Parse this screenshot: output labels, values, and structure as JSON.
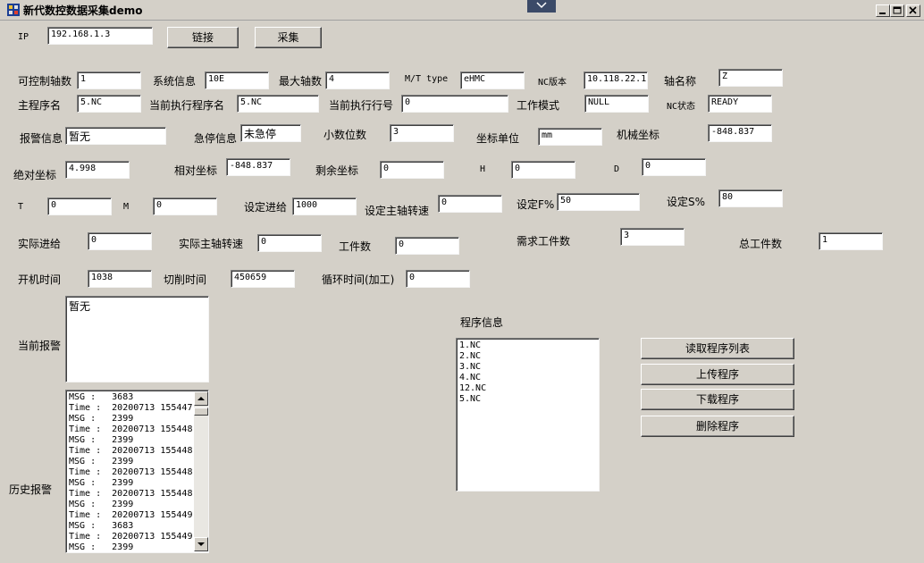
{
  "window": {
    "title": "新代数控数据采集demo",
    "controls": {
      "minimize": "minimize",
      "maximize": "maximize",
      "close": "close"
    }
  },
  "connection": {
    "ip_label": "IP",
    "ip_value": "192.168.1.3",
    "connect_label": "链接",
    "collect_label": "采集"
  },
  "fields": {
    "axis_count": {
      "label": "可控制轴数",
      "value": "1"
    },
    "sys_info": {
      "label": "系统信息",
      "value": "10E"
    },
    "max_axis": {
      "label": "最大轴数",
      "value": "4"
    },
    "mt_type": {
      "label": "M/T type",
      "value": "eHMC"
    },
    "nc_version": {
      "label": "NC版本",
      "value": "10.118.22.1"
    },
    "axis_name": {
      "label": "轴名称",
      "value": "Z"
    },
    "main_prog": {
      "label": "主程序名",
      "value": "5.NC"
    },
    "cur_prog": {
      "label": "当前执行程序名",
      "value": "5.NC"
    },
    "cur_line": {
      "label": "当前执行行号",
      "value": "0"
    },
    "work_mode": {
      "label": "工作模式",
      "value": "NULL"
    },
    "nc_status": {
      "label": "NC状态",
      "value": "READY"
    },
    "alarm_info": {
      "label": "报警信息",
      "value": "暂无"
    },
    "estop_info": {
      "label": "急停信息",
      "value": "未急停"
    },
    "decimals": {
      "label": "小数位数",
      "value": "3"
    },
    "coord_unit": {
      "label": "坐标单位",
      "value": "mm"
    },
    "mach_coord": {
      "label": "机械坐标",
      "value": "-848.837"
    },
    "abs_coord": {
      "label": "绝对坐标",
      "value": "4.998"
    },
    "rel_coord": {
      "label": "相对坐标",
      "value": "-848.837"
    },
    "remain_coord": {
      "label": "剩余坐标",
      "value": "0"
    },
    "h": {
      "label": "H",
      "value": "0"
    },
    "d": {
      "label": "D",
      "value": "0"
    },
    "t": {
      "label": "T",
      "value": "0"
    },
    "m": {
      "label": "M",
      "value": "0"
    },
    "set_feed": {
      "label": "设定进给",
      "value": "1000"
    },
    "set_spindle": {
      "label": "设定主轴转速",
      "value": "0"
    },
    "set_f_pct": {
      "label": "设定F%",
      "value": "50"
    },
    "set_s_pct": {
      "label": "设定S%",
      "value": "80"
    },
    "act_feed": {
      "label": "实际进给",
      "value": "0"
    },
    "act_spindle": {
      "label": "实际主轴转速",
      "value": "0"
    },
    "part_count": {
      "label": "工件数",
      "value": "0"
    },
    "req_parts": {
      "label": "需求工件数",
      "value": "3"
    },
    "total_parts": {
      "label": "总工件数",
      "value": "1"
    },
    "power_time": {
      "label": "开机时间",
      "value": "1038"
    },
    "cut_time": {
      "label": "切削时间",
      "value": "450659"
    },
    "cycle_time": {
      "label": "循环时间(加工)",
      "value": "0"
    }
  },
  "current_alarm": {
    "label": "当前报警",
    "text": "暂无"
  },
  "history_alarm": {
    "label": "历史报警",
    "lines": [
      "MSG :   3683",
      "Time :  20200713 155447",
      "MSG :   2399",
      "Time :  20200713 155448",
      "MSG :   2399",
      "Time :  20200713 155448",
      "MSG :   2399",
      "Time :  20200713 155448",
      "MSG :   2399",
      "Time :  20200713 155448",
      "MSG :   2399",
      "Time :  20200713 155449",
      "MSG :   3683",
      "Time :  20200713 155449",
      "MSG :   2399"
    ]
  },
  "program_info": {
    "label": "程序信息",
    "items": [
      "1.NC",
      "2.NC",
      "3.NC",
      "4.NC",
      "12.NC",
      "5.NC"
    ]
  },
  "program_buttons": {
    "read_list": "读取程序列表",
    "upload": "上传程序",
    "download": "下载程序",
    "delete": "删除程序"
  }
}
